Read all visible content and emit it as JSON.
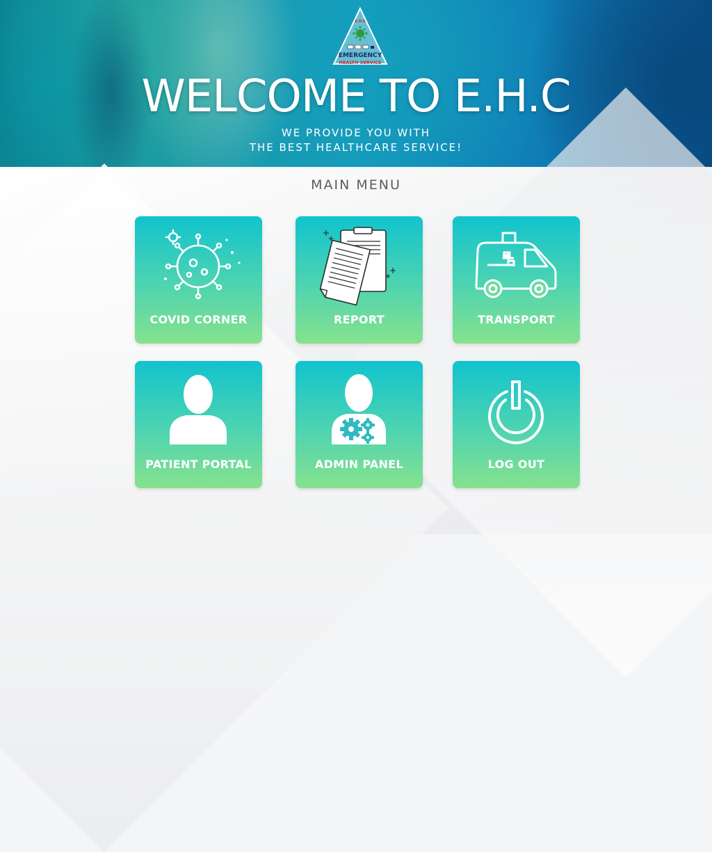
{
  "header": {
    "logo": {
      "abbr": "E.H.S",
      "line1": "EMERGENCY",
      "line2": "HEALTH SERVICE"
    },
    "title": "WELCOME TO E.H.C",
    "tagline_line1": "WE PROVIDE YOU WITH",
    "tagline_line2": "THE BEST HEALTHCARE SERVICE!"
  },
  "menu": {
    "title": "MAIN MENU",
    "tiles": [
      {
        "label": "COVID CORNER",
        "icon": "virus-icon"
      },
      {
        "label": "REPORT",
        "icon": "clipboard-report-icon"
      },
      {
        "label": "TRANSPORT",
        "icon": "ambulance-icon"
      },
      {
        "label": "PATIENT PORTAL",
        "icon": "user-icon"
      },
      {
        "label": "ADMIN PANEL",
        "icon": "admin-gears-icon"
      },
      {
        "label": "LOG OUT",
        "icon": "power-icon"
      }
    ]
  },
  "colors": {
    "tile_top": "#11c3ce",
    "tile_bottom": "#86e28d",
    "banner_blue": "#0f7fb6",
    "logo_red": "#d62828",
    "logo_navy": "#1b2a6b"
  }
}
